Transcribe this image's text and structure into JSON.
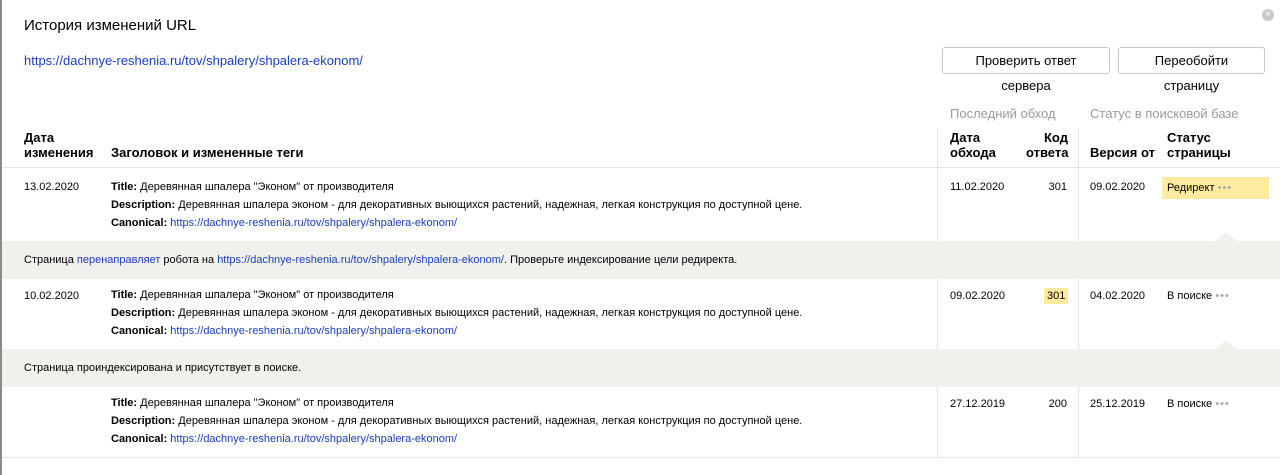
{
  "header": {
    "title": "История изменений URL",
    "url": "https://dachnye-reshenia.ru/tov/shpalery/shpalera-ekonom/",
    "check_button": "Проверить ответ сервера",
    "recrawl_button": "Переобойти страницу",
    "close_icon": "×"
  },
  "columns": {
    "group_last_crawl": "Последний обход",
    "group_search_status": "Статус в поисковой базе",
    "change_date": [
      "Дата",
      "изменения"
    ],
    "title_tags": "Заголовок и измененные теги",
    "crawl_date": [
      "Дата",
      "обхода"
    ],
    "response_code": [
      "Код",
      "ответа"
    ],
    "version_from": "Версия от",
    "page_status": [
      "Статус",
      "страницы"
    ]
  },
  "labels": {
    "title": "Title:",
    "description": "Description:",
    "canonical": "Canonical:"
  },
  "rows": [
    {
      "change_date": "13.02.2020",
      "title": "Деревянная шпалера \"Эконом\" от производителя",
      "description": "Деревянная шпалера эконом - для декоративных выющихся растений, надежная, легкая конструкция по доступной цене.",
      "canonical": "https://dachnye-reshenia.ru/tov/shpalery/shpalera-ekonom/",
      "crawl_date": "11.02.2020",
      "response_code": "301",
      "version_from": "09.02.2020",
      "page_status": "Редирект",
      "more": "•••"
    },
    {
      "change_date": "10.02.2020",
      "title": "Деревянная шпалера \"Эконом\" от производителя",
      "description": "Деревянная шпалера эконом - для декоративных выющихся растений, надежная, легкая конструкция по доступной цене.",
      "canonical": "https://dachnye-reshenia.ru/tov/shpalery/shpalera-ekonom/",
      "crawl_date": "09.02.2020",
      "response_code": "301",
      "version_from": "04.02.2020",
      "page_status": "В поиске",
      "more": "•••"
    },
    {
      "change_date": "",
      "title": "Деревянная шпалера \"Эконом\" от производителя",
      "description": "Деревянная шпалера эконом - для декоративных выющихся растений, надежная, легкая конструкция по доступной цене.",
      "canonical": "https://dachnye-reshenia.ru/tov/shpalery/shpalera-ekonom/",
      "crawl_date": "27.12.2019",
      "response_code": "200",
      "version_from": "25.12.2019",
      "page_status": "В поиске",
      "more": "•••"
    }
  ],
  "notes": {
    "redirect_prefix": "Страница ",
    "redirect_link": "перенаправляет",
    "redirect_middle": " робота на ",
    "redirect_url": "https://dachnye-reshenia.ru/tov/shpalery/shpalera-ekonom/",
    "redirect_suffix": ". Проверьте индексирование цели редиректа.",
    "indexed": "Страница проиндексирована и присутствует в поиске."
  },
  "colors": {
    "link": "#1a3dc1",
    "highlight": "#ffeba0",
    "note_background": "#f1f0ec"
  }
}
